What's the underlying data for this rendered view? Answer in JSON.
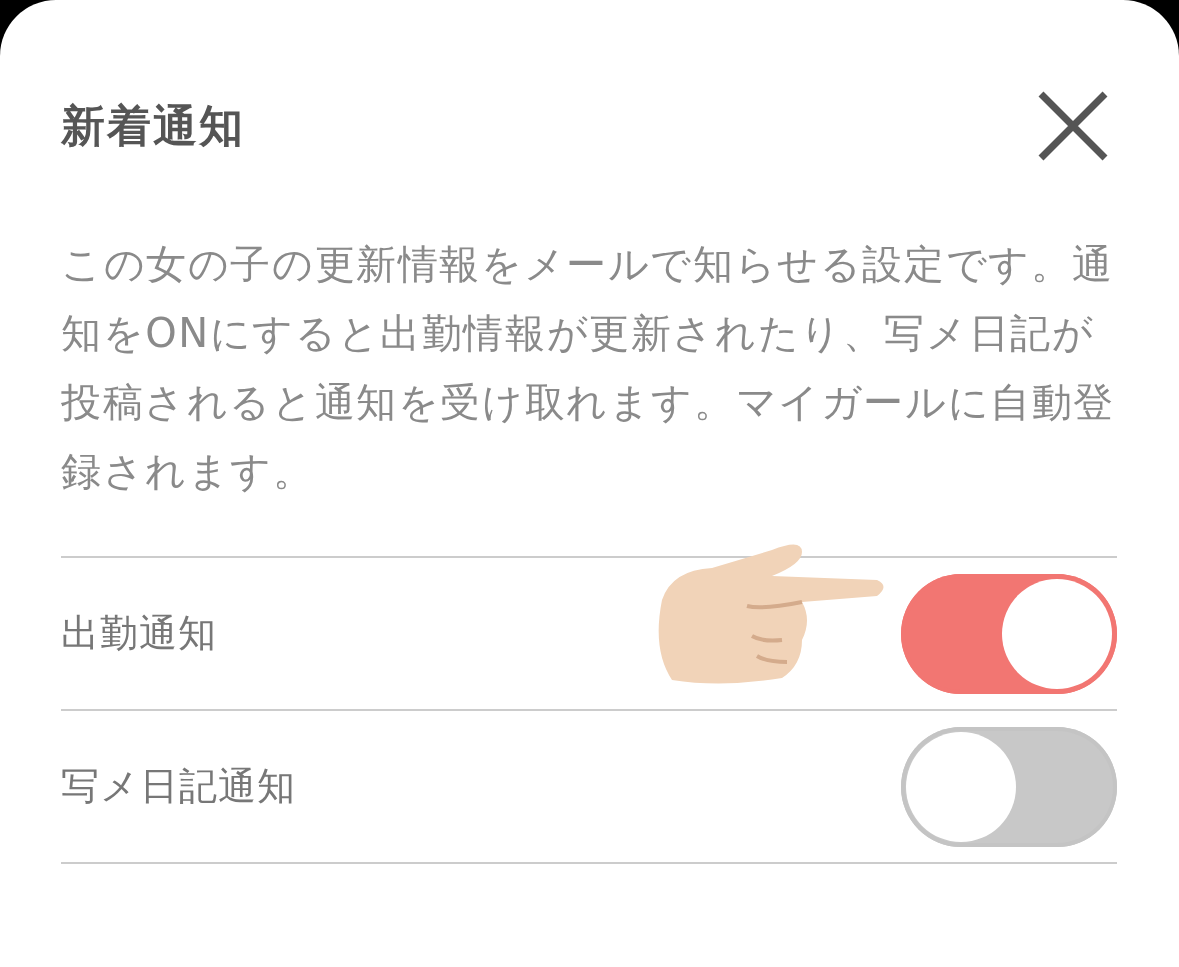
{
  "dialog": {
    "title": "新着通知",
    "description": "この女の子の更新情報をメールで知らせる設定です。通知をONにすると出勤情報が更新されたり、写メ日記が投稿されると通知を受け取れます。マイガールに自動登録されます。"
  },
  "settings": [
    {
      "label": "出勤通知",
      "on": true,
      "pointer": true
    },
    {
      "label": "写メ日記通知",
      "on": false,
      "pointer": false
    }
  ]
}
